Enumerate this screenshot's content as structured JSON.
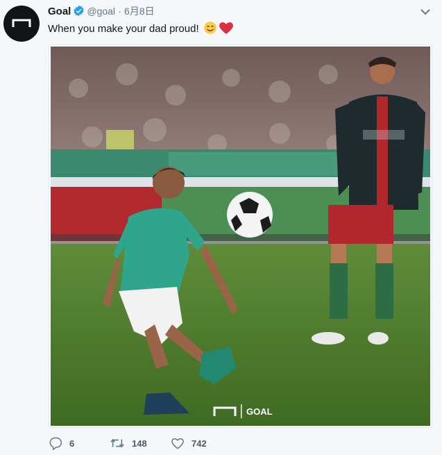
{
  "tweet": {
    "author_name": "Goal",
    "author_handle": "@goal",
    "separator": "·",
    "date": "6月8日",
    "text": "When you make your dad proud!",
    "emojis": [
      "smiling-face-icon",
      "red-heart-icon"
    ],
    "media_watermark": "GOAL",
    "actions": {
      "reply_count": "6",
      "retweet_count": "148",
      "like_count": "742"
    }
  },
  "colors": {
    "verified": "#1da1f2",
    "secondary_text": "#657786",
    "background": "#f5f8fa"
  }
}
